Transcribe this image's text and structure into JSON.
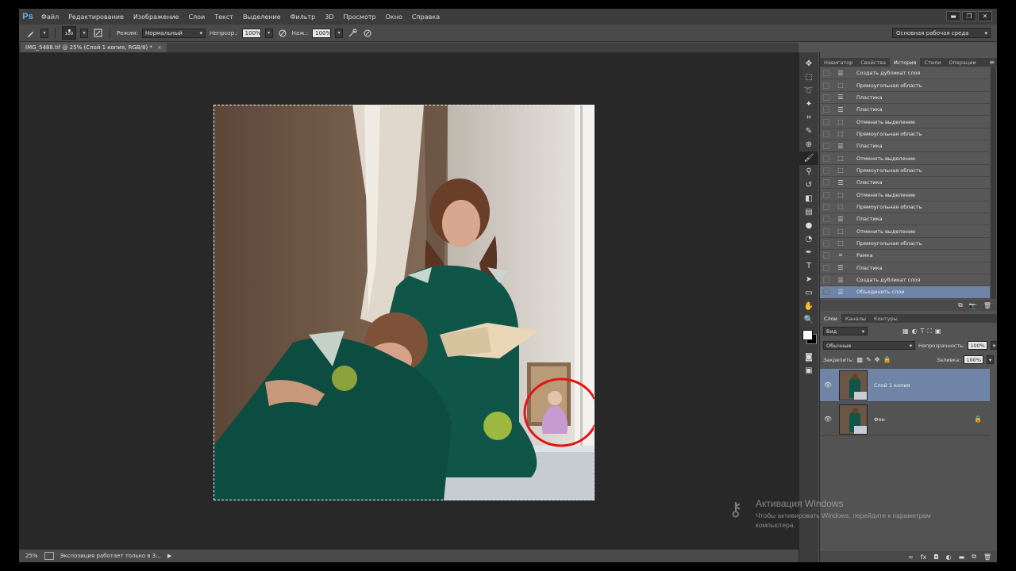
{
  "app": {
    "logo": "Ps",
    "menu": [
      "Файл",
      "Редактирование",
      "Изображение",
      "Слои",
      "Текст",
      "Выделение",
      "Фильтр",
      "3D",
      "Просмотр",
      "Окно",
      "Справка"
    ],
    "window_buttons": [
      "▬",
      "❐",
      "✕"
    ]
  },
  "options": {
    "brush_size": "100",
    "mode_label": "Режим:",
    "mode_value": "Нормальный",
    "opacity_label": "Непрозр.:",
    "opacity_value": "100%",
    "flow_label": "Наж.:",
    "flow_value": "100%",
    "workspace": "Основная рабочая среда"
  },
  "document": {
    "tab_title": "IMG_5488.tif @ 25% (Слой 1 копия, RGB/8) *",
    "zoom": "25%",
    "status_text": "Экспозиция работает только в 3..."
  },
  "history_panel": {
    "tabs": [
      "Навигатор",
      "Свойства",
      "История",
      "Стили",
      "Операции"
    ],
    "active_tab": "История",
    "items": [
      {
        "label": "Создать дубликат слоя",
        "icon": "layer-icon"
      },
      {
        "label": "Прямоугольная область",
        "icon": "marquee-icon"
      },
      {
        "label": "Пластика",
        "icon": "layer-icon"
      },
      {
        "label": "Пластика",
        "icon": "layer-icon"
      },
      {
        "label": "Отменить выделение",
        "icon": "marquee-icon"
      },
      {
        "label": "Прямоугольная область",
        "icon": "marquee-icon"
      },
      {
        "label": "Пластика",
        "icon": "layer-icon"
      },
      {
        "label": "Отменить выделение",
        "icon": "marquee-icon"
      },
      {
        "label": "Прямоугольная область",
        "icon": "marquee-icon"
      },
      {
        "label": "Пластика",
        "icon": "layer-icon"
      },
      {
        "label": "Отменить выделение",
        "icon": "marquee-icon"
      },
      {
        "label": "Прямоугольная область",
        "icon": "marquee-icon"
      },
      {
        "label": "Пластика",
        "icon": "layer-icon"
      },
      {
        "label": "Отменить выделение",
        "icon": "marquee-icon"
      },
      {
        "label": "Прямоугольная область",
        "icon": "marquee-icon"
      },
      {
        "label": "Рамка",
        "icon": "crop-icon"
      },
      {
        "label": "Пластика",
        "icon": "layer-icon"
      },
      {
        "label": "Создать дубликат слоя",
        "icon": "layer-icon"
      },
      {
        "label": "Объединить слои",
        "icon": "layer-icon"
      }
    ]
  },
  "layers_panel": {
    "tabs": [
      "Слои",
      "Каналы",
      "Контуры"
    ],
    "active_tab": "Слои",
    "filter_kind": "Вид",
    "blend_mode": "Обычные",
    "opacity_label": "Непрозрачность:",
    "opacity_value": "100%",
    "lock_label": "Закрепить:",
    "fill_label": "Заливка:",
    "fill_value": "100%",
    "layers": [
      {
        "name": "Слой 1 копия",
        "selected": true,
        "locked": false
      },
      {
        "name": "Фон",
        "selected": false,
        "locked": true
      }
    ]
  },
  "watermark": {
    "title": "Активация Windows",
    "line1": "Чтобы активировать Windows, перейдите к параметрам",
    "line2": "компьютера."
  },
  "colors": {
    "selection_blue": "#6f84a6",
    "annotation_red": "#e01515"
  }
}
